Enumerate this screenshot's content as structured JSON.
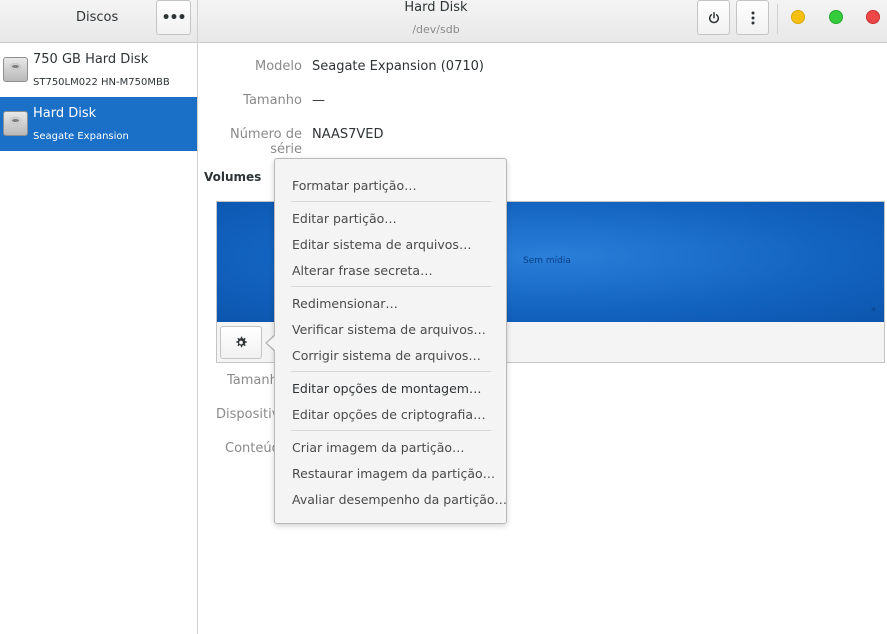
{
  "headerbar": {
    "left_title": "Discos",
    "title": "Hard Disk",
    "subtitle": "/dev/sdb",
    "more_icon": "more-horizontal-icon",
    "power_icon": "power-icon",
    "menu_icon": "vertical-dots-icon",
    "window_colors": {
      "minimize": "#f5c010",
      "maximize": "#35cc3c",
      "close": "#f04848"
    }
  },
  "sidebar": {
    "items": [
      {
        "name": "750 GB Hard Disk",
        "sub": "ST750LM022 HN-M750MBB",
        "selected": false
      },
      {
        "name": "Hard Disk",
        "sub": "Seagate Expansion",
        "selected": true
      }
    ],
    "accent": "#1a6fc7"
  },
  "details": {
    "model_label": "Modelo",
    "model_value": "Seagate Expansion (0710)",
    "size_label": "Tamanho",
    "size_value": "—",
    "serial_label": "Número de série",
    "serial_value": "NAAS7VED"
  },
  "volumes": {
    "heading": "Volumes",
    "empty_label": "Sem mídia",
    "corner_mark": "*",
    "size_label_partial": "Tamanh",
    "device_label_partial": "Dispositiv",
    "content_label_partial": "Conteúd",
    "gear_icon": "gear-icon"
  },
  "menu": {
    "groups": [
      [
        "Formatar partição…"
      ],
      [
        "Editar partição…",
        "Editar sistema de arquivos…",
        "Alterar frase secreta…"
      ],
      [
        "Redimensionar…",
        "Verificar sistema de arquivos…",
        "Corrigir sistema de arquivos…"
      ],
      [
        "Editar opções de montagem…",
        "Editar opções de criptografia…"
      ],
      [
        "Criar imagem da partição…",
        "Restaurar imagem da partição…",
        "Avaliar desempenho da partição…"
      ]
    ]
  }
}
